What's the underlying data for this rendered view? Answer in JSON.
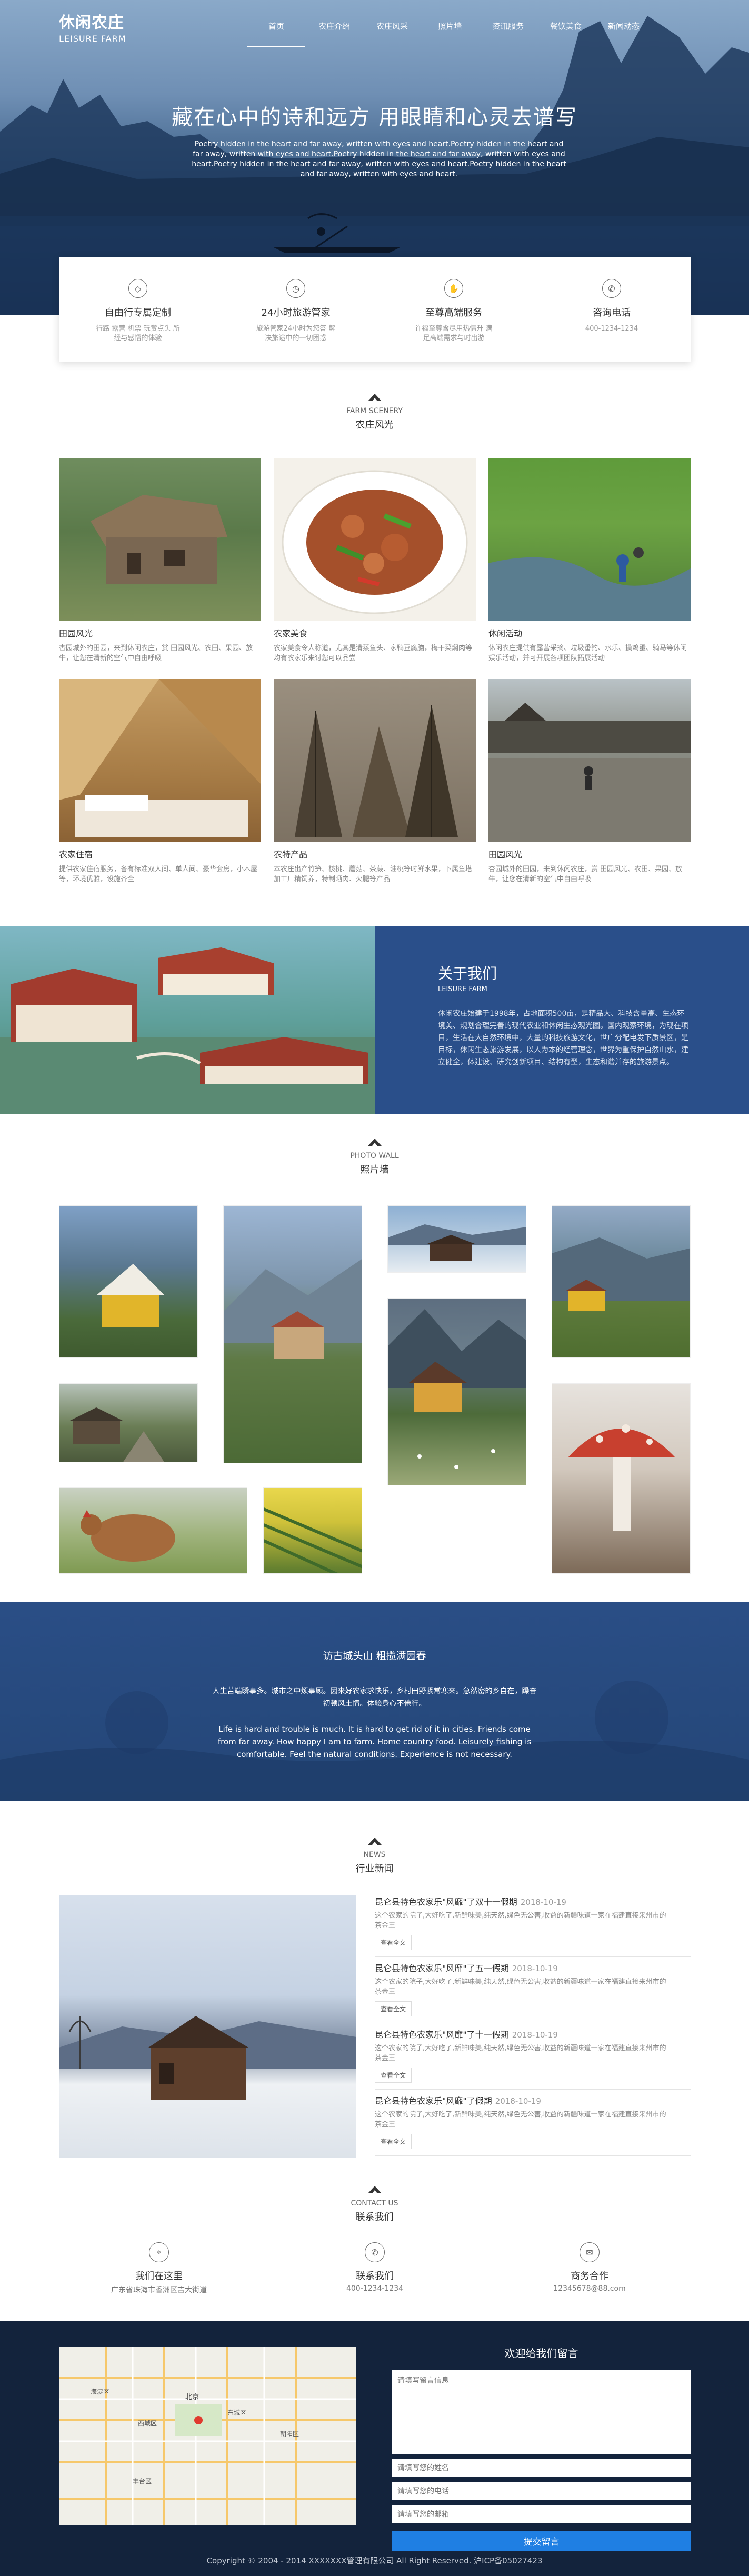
{
  "header": {
    "logo_cn": "休闲农庄",
    "logo_en": "LEISURE FARM",
    "nav": [
      "首页",
      "农庄介绍",
      "农庄风采",
      "照片墙",
      "资讯服务",
      "餐饮美食",
      "新闻动态"
    ],
    "active_index": 0
  },
  "hero": {
    "title": "藏在心中的诗和远方 用眼睛和心灵去谱写",
    "subtitle": "Poetry hidden in the heart and far away, written with eyes and heart.Poetry hidden in the heart and far away, written with eyes and heart.Poetry hidden in the heart and far away, written with eyes and heart.Poetry hidden in the heart and far away, written with eyes and heart.Poetry hidden in the heart and far away, written with eyes and heart."
  },
  "features": [
    {
      "icon": "diamond-icon",
      "title": "自由行专属定制",
      "desc": "行路 露营 机票 玩赏点头 所经与感悟的体验"
    },
    {
      "icon": "clock-icon",
      "title": "24小时旅游管家",
      "desc": "旅游管家24小时为您答 解决旅途中的一切困惑"
    },
    {
      "icon": "handshake-icon",
      "title": "至尊高端服务",
      "desc": "许福至尊含尽用热情升 满足高端需求与时出游"
    },
    {
      "icon": "phone-icon",
      "title": "咨询电话",
      "desc": "400-1234-1234"
    }
  ],
  "scenery": {
    "title_en": "FARM SCENERY",
    "title_cn": "农庄风光",
    "items": [
      {
        "name": "田园风光",
        "desc": "杏园城外的田园，来到休闲农庄，赏 田园风光、农田、果园、放牛，让您在清新的空气中自由呼吸"
      },
      {
        "name": "农家美食",
        "desc": "农家美食令人称道，尤其是清蒸鱼头、家鸭豆腐脑，梅干菜焖肉等均有农家乐来讨您可以品尝"
      },
      {
        "name": "休闲活动",
        "desc": "休闲农庄提供有露营采摘、垃圾番钓、水乐、摸鸡蛋、骑马等休闲娱乐活动，并可开展各项团队拓展活动"
      },
      {
        "name": "农家住宿",
        "desc": "提供农家住宿服务，备有标准双人间、单人间、豪华套房，小木屋等，环境优雅，设施齐全"
      },
      {
        "name": "农特产品",
        "desc": "本农庄出产竹笋、核桃、蘑菇、茶蕨、油桃等时鲜水果，下属鱼塔加工厂精饲养，特制晒肉、火腿等产品"
      },
      {
        "name": "田园风光",
        "desc": "杏园城外的田园，来到休闲农庄，赏 田园风光、农田、果园、放牛，让您在清新的空气中自由呼吸"
      }
    ]
  },
  "about": {
    "title": "关于我们",
    "subtitle": "LEISURE FARM",
    "text": "休闲农庄始建于1998年，占地面积500亩，是精品大、科技含量高、生态环境美、规划合理完善的现代农业和休闲生态观光园。国内观察环境，为现在项目，生活在大自然环境中，大量的科技旅游文化，世广分配电发下质景区，是目标，休闲生态旅游发展，以人为本的经营理念，世界为重保护自然山水，建立健全，体建设、研究创新项目、结构有型，生态和谐并存的旅游景点。"
  },
  "photos": {
    "title_en": "PHOTO WALL",
    "title_cn": "照片墙"
  },
  "quote": {
    "title": "访古城头山 粗揽满园春",
    "cn": "人生苦端瞬事多。城市之中烦事顾。因来好农家求快乐，乡村田野紧常寒来。急然密的乡自在，躁奋初顿风土情。体验身心不倦行。",
    "en": "Life is hard and trouble is much. It is hard to get rid of it in cities. Friends come from far away. How happy I am to farm. Home country food. Leisurely fishing is comfortable. Feel the natural conditions. Experience is not necessary."
  },
  "news": {
    "title_en": "NEWS",
    "title_cn": "行业新闻",
    "items": [
      {
        "title": "昆仑县特色农家乐\"风靡\"了双十一假期",
        "date": "2018-10-19",
        "body": "这个农家的院子,大好吃了,新鲜味美,纯天然,绿色无公害,收益的新疆味道一家在福建直接来州市的茶金王",
        "btn": "查看全文"
      },
      {
        "title": "昆仑县特色农家乐\"风靡\"了五一假期",
        "date": "2018-10-19",
        "body": "这个农家的院子,大好吃了,新鲜味美,纯天然,绿色无公害,收益的新疆味道一家在福建直接来州市的茶金王",
        "btn": "查看全文"
      },
      {
        "title": "昆仑县特色农家乐\"风靡\"了十一假期",
        "date": "2018-10-19",
        "body": "这个农家的院子,大好吃了,新鲜味美,纯天然,绿色无公害,收益的新疆味道一家在福建直接来州市的茶金王",
        "btn": "查看全文"
      },
      {
        "title": "昆仑县特色农家乐\"风靡\"了假期",
        "date": "2018-10-19",
        "body": "这个农家的院子,大好吃了,新鲜味美,纯天然,绿色无公害,收益的新疆味道一家在福建直接来州市的茶金王",
        "btn": "查看全文"
      }
    ]
  },
  "contact": {
    "title_en": "CONTACT US",
    "title_cn": "联系我们",
    "items": [
      {
        "icon": "location-icon",
        "title": "我们在这里",
        "desc": "广东省珠海市香洲区吉大街道"
      },
      {
        "icon": "phone-icon",
        "title": "联系我们",
        "desc": "400-1234-1234"
      },
      {
        "icon": "mail-icon",
        "title": "商务合作",
        "desc": "12345678@88.com"
      }
    ]
  },
  "footer": {
    "form_title": "欢迎给我们留言",
    "textarea_ph": "请填写留言信息",
    "name_ph": "请填写您的姓名",
    "phone_ph": "请填写您的电话",
    "email_ph": "请填写您的邮箱",
    "submit": "提交留言",
    "copyright": "Copyright © 2004 - 2014 XXXXXXX管理有限公司 All Right Reserved. 沪ICP备05027423",
    "map_labels": [
      "北京",
      "东城区",
      "西城区",
      "朝阳区",
      "海淀区",
      "丰台区"
    ]
  }
}
